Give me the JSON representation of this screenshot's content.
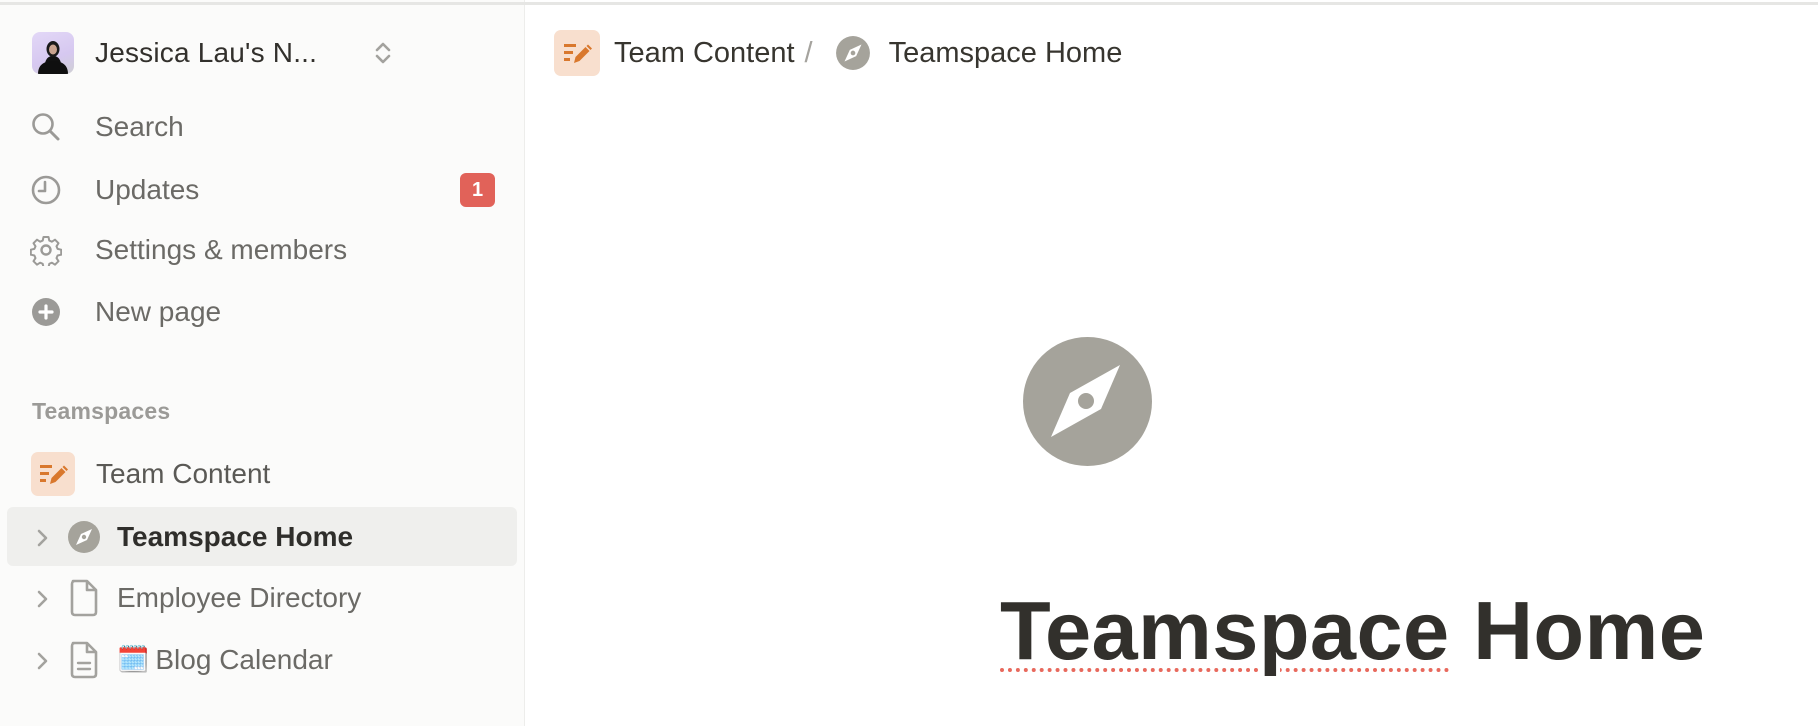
{
  "workspace": {
    "name": "Jessica Lau's N...",
    "avatar_icon": "user-avatar",
    "switcher_icon": "chevron-up-down-icon"
  },
  "sidebar": {
    "nav": [
      {
        "label": "Search",
        "icon": "search-icon"
      },
      {
        "label": "Updates",
        "icon": "clock-icon",
        "badge": "1"
      },
      {
        "label": "Settings & members",
        "icon": "gear-icon"
      },
      {
        "label": "New page",
        "icon": "plus-circle-icon"
      }
    ],
    "section_title": "Teamspaces",
    "teamspace": {
      "label": "Team Content",
      "icon": "edit-lines-icon"
    },
    "pages": [
      {
        "label": "Teamspace Home",
        "icon": "compass-icon",
        "selected": true
      },
      {
        "label": "Employee Directory",
        "icon": "document-icon",
        "selected": false
      },
      {
        "label": "Blog Calendar",
        "icon": "document-text-icon",
        "emoji": "🗓️",
        "selected": false
      }
    ]
  },
  "breadcrumb": {
    "items": [
      {
        "label": "Team Content",
        "icon": "edit-lines-icon"
      },
      {
        "label": "Teamspace Home",
        "icon": "compass-icon"
      }
    ],
    "separator": "/"
  },
  "page": {
    "icon": "compass-icon",
    "title_word1": "Teamspace",
    "title_word2": " Home"
  },
  "colors": {
    "accent_orange": "#D9782D",
    "accent_peach_bg": "#F8DFCE",
    "badge_red": "#E16259",
    "icon_grey": "#A5A39B",
    "sidebar_bg": "#FBFBFA",
    "selected_row_bg": "#EFEFED"
  }
}
